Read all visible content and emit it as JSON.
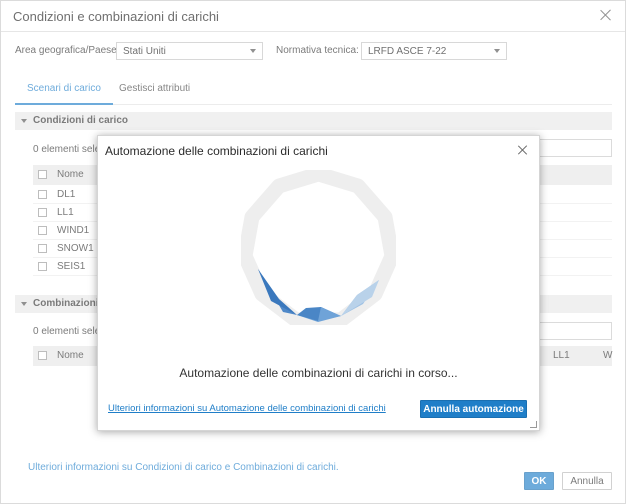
{
  "window": {
    "title": "Condizioni e combinazioni di carichi"
  },
  "filters": {
    "area_label": "Area geografica/Paese:",
    "area_value": "Stati Uniti",
    "code_label": "Normativa tecnica:",
    "code_value": "LRFD ASCE 7-22"
  },
  "tabs": [
    {
      "label": "Scenari di carico",
      "active": true
    },
    {
      "label": "Gestisci attributi",
      "active": false
    }
  ],
  "load_conditions": {
    "section_title": "Condizioni di carico",
    "selected_count": "0 elementi sele:",
    "column_name": "Nome",
    "rows": [
      "DL1",
      "LL1",
      "WIND1",
      "SNOW1",
      "SEIS1"
    ]
  },
  "combinations": {
    "section_title": "Combinazioni di",
    "selected_count": "0 elementi sele:",
    "column_name": "Nome",
    "column_ll1": "LL1",
    "column_w": "W"
  },
  "footer": {
    "link": "Ulteriori informazioni su Condizioni di carico e Combinazioni di carichi.",
    "ok": "OK",
    "cancel": "Annulla"
  },
  "modal": {
    "title": "Automazione delle combinazioni di carichi",
    "progress_text": "Automazione delle combinazioni di carichi in corso...",
    "info_link": "Ulteriori informazioni su Automazione delle combinazioni di carichi",
    "cancel_button": "Annulla automazione"
  },
  "colors": {
    "accent": "#1f7ec8",
    "spinner_track": "#eeeeee",
    "spinner_dark": "#3a78bd",
    "spinner_light": "#b9d2ea"
  }
}
